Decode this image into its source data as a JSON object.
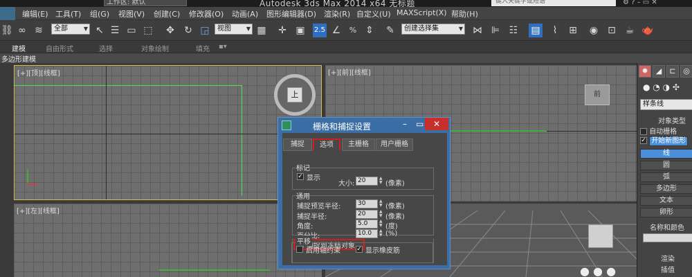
{
  "titlebar": {
    "workspace": "工作区: 默认",
    "app_title": "Autodesk 3ds Max  2014 x64    无标题",
    "search_placeholder": "键入关键字或短语"
  },
  "menu": [
    "编辑(E)",
    "工具(T)",
    "组(G)",
    "视图(V)",
    "创建(C)",
    "修改器(O)",
    "动画(A)",
    "图形编辑器(D)",
    "渲染(R)",
    "自定义(U)",
    "MAXScript(X)",
    "帮助(H)"
  ],
  "toolbar": {
    "selection_filter": "全部",
    "reference_coord": "视图",
    "snap_value": "2.5",
    "named_selection": "创建选择集"
  },
  "ribbon": {
    "tabs": [
      "建模",
      "自由形式",
      "选择",
      "对象绘制",
      "填充"
    ],
    "panel_label": "多边形建模"
  },
  "viewports": {
    "top": "[+][顶][线框]",
    "front": "[+][前][线框]",
    "left": "[+][左][线框]",
    "viewcube_top": "上",
    "viewcube_front": "前"
  },
  "command_panel": {
    "category": "样条线",
    "object_type": "对象类型",
    "auto_grid": "自动栅格",
    "start_new_shape": "开始新图形",
    "buttons": [
      "线",
      "圆",
      "弧",
      "多边形",
      "文本",
      "卵形"
    ],
    "name_color": "名称和颜色",
    "rendering": "渲染",
    "interpolation": "插值"
  },
  "dialog": {
    "title": "栅格和捕捉设置",
    "tabs": [
      "捕捉",
      "选项",
      "主栅格",
      "用户栅格"
    ],
    "marker": {
      "title": "标记",
      "display": "显示",
      "size_label": "大小:",
      "size_value": "20",
      "size_unit": "(像素)"
    },
    "general": {
      "title": "通用",
      "preview_radius_label": "捕捉预览半径:",
      "preview_radius_value": "30",
      "preview_radius_unit": "(像素)",
      "snap_radius_label": "捕捉半径:",
      "snap_radius_value": "20",
      "snap_radius_unit": "(像素)",
      "angle_label": "角度:",
      "angle_value": "5.0",
      "angle_unit": "(度)",
      "percent_label": "百分比:",
      "percent_value": "10.0",
      "percent_unit": "(%)",
      "snap_frozen": "捕捉到冻结对象"
    },
    "translation": {
      "title": "平移",
      "axis_constraints": "启用轴约束",
      "rubber_band": "显示橡皮筋"
    }
  }
}
